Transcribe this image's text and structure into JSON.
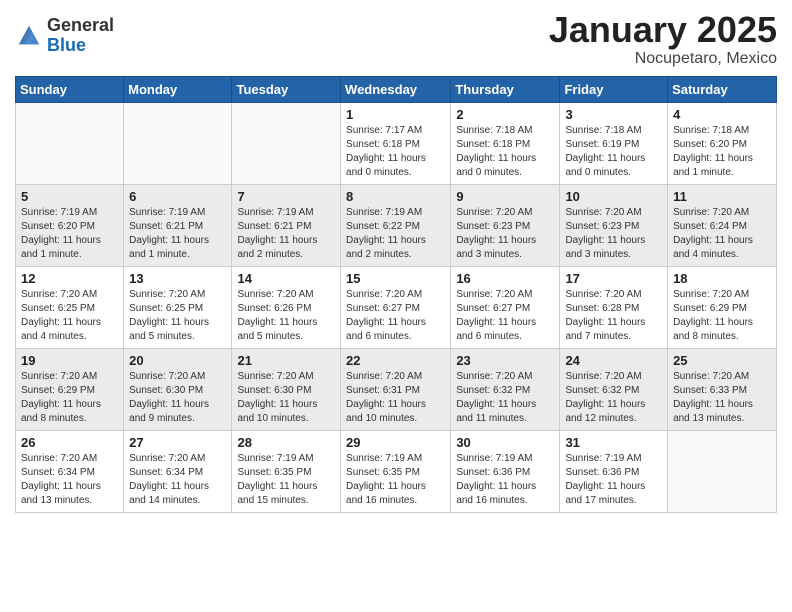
{
  "header": {
    "logo_general": "General",
    "logo_blue": "Blue",
    "month_title": "January 2025",
    "location": "Nocupetaro, Mexico"
  },
  "days_of_week": [
    "Sunday",
    "Monday",
    "Tuesday",
    "Wednesday",
    "Thursday",
    "Friday",
    "Saturday"
  ],
  "weeks": [
    [
      {
        "num": "",
        "info": ""
      },
      {
        "num": "",
        "info": ""
      },
      {
        "num": "",
        "info": ""
      },
      {
        "num": "1",
        "info": "Sunrise: 7:17 AM\nSunset: 6:18 PM\nDaylight: 11 hours and 0 minutes."
      },
      {
        "num": "2",
        "info": "Sunrise: 7:18 AM\nSunset: 6:18 PM\nDaylight: 11 hours and 0 minutes."
      },
      {
        "num": "3",
        "info": "Sunrise: 7:18 AM\nSunset: 6:19 PM\nDaylight: 11 hours and 0 minutes."
      },
      {
        "num": "4",
        "info": "Sunrise: 7:18 AM\nSunset: 6:20 PM\nDaylight: 11 hours and 1 minute."
      }
    ],
    [
      {
        "num": "5",
        "info": "Sunrise: 7:19 AM\nSunset: 6:20 PM\nDaylight: 11 hours and 1 minute."
      },
      {
        "num": "6",
        "info": "Sunrise: 7:19 AM\nSunset: 6:21 PM\nDaylight: 11 hours and 1 minute."
      },
      {
        "num": "7",
        "info": "Sunrise: 7:19 AM\nSunset: 6:21 PM\nDaylight: 11 hours and 2 minutes."
      },
      {
        "num": "8",
        "info": "Sunrise: 7:19 AM\nSunset: 6:22 PM\nDaylight: 11 hours and 2 minutes."
      },
      {
        "num": "9",
        "info": "Sunrise: 7:20 AM\nSunset: 6:23 PM\nDaylight: 11 hours and 3 minutes."
      },
      {
        "num": "10",
        "info": "Sunrise: 7:20 AM\nSunset: 6:23 PM\nDaylight: 11 hours and 3 minutes."
      },
      {
        "num": "11",
        "info": "Sunrise: 7:20 AM\nSunset: 6:24 PM\nDaylight: 11 hours and 4 minutes."
      }
    ],
    [
      {
        "num": "12",
        "info": "Sunrise: 7:20 AM\nSunset: 6:25 PM\nDaylight: 11 hours and 4 minutes."
      },
      {
        "num": "13",
        "info": "Sunrise: 7:20 AM\nSunset: 6:25 PM\nDaylight: 11 hours and 5 minutes."
      },
      {
        "num": "14",
        "info": "Sunrise: 7:20 AM\nSunset: 6:26 PM\nDaylight: 11 hours and 5 minutes."
      },
      {
        "num": "15",
        "info": "Sunrise: 7:20 AM\nSunset: 6:27 PM\nDaylight: 11 hours and 6 minutes."
      },
      {
        "num": "16",
        "info": "Sunrise: 7:20 AM\nSunset: 6:27 PM\nDaylight: 11 hours and 6 minutes."
      },
      {
        "num": "17",
        "info": "Sunrise: 7:20 AM\nSunset: 6:28 PM\nDaylight: 11 hours and 7 minutes."
      },
      {
        "num": "18",
        "info": "Sunrise: 7:20 AM\nSunset: 6:29 PM\nDaylight: 11 hours and 8 minutes."
      }
    ],
    [
      {
        "num": "19",
        "info": "Sunrise: 7:20 AM\nSunset: 6:29 PM\nDaylight: 11 hours and 8 minutes."
      },
      {
        "num": "20",
        "info": "Sunrise: 7:20 AM\nSunset: 6:30 PM\nDaylight: 11 hours and 9 minutes."
      },
      {
        "num": "21",
        "info": "Sunrise: 7:20 AM\nSunset: 6:30 PM\nDaylight: 11 hours and 10 minutes."
      },
      {
        "num": "22",
        "info": "Sunrise: 7:20 AM\nSunset: 6:31 PM\nDaylight: 11 hours and 10 minutes."
      },
      {
        "num": "23",
        "info": "Sunrise: 7:20 AM\nSunset: 6:32 PM\nDaylight: 11 hours and 11 minutes."
      },
      {
        "num": "24",
        "info": "Sunrise: 7:20 AM\nSunset: 6:32 PM\nDaylight: 11 hours and 12 minutes."
      },
      {
        "num": "25",
        "info": "Sunrise: 7:20 AM\nSunset: 6:33 PM\nDaylight: 11 hours and 13 minutes."
      }
    ],
    [
      {
        "num": "26",
        "info": "Sunrise: 7:20 AM\nSunset: 6:34 PM\nDaylight: 11 hours and 13 minutes."
      },
      {
        "num": "27",
        "info": "Sunrise: 7:20 AM\nSunset: 6:34 PM\nDaylight: 11 hours and 14 minutes."
      },
      {
        "num": "28",
        "info": "Sunrise: 7:19 AM\nSunset: 6:35 PM\nDaylight: 11 hours and 15 minutes."
      },
      {
        "num": "29",
        "info": "Sunrise: 7:19 AM\nSunset: 6:35 PM\nDaylight: 11 hours and 16 minutes."
      },
      {
        "num": "30",
        "info": "Sunrise: 7:19 AM\nSunset: 6:36 PM\nDaylight: 11 hours and 16 minutes."
      },
      {
        "num": "31",
        "info": "Sunrise: 7:19 AM\nSunset: 6:36 PM\nDaylight: 11 hours and 17 minutes."
      },
      {
        "num": "",
        "info": ""
      }
    ]
  ]
}
